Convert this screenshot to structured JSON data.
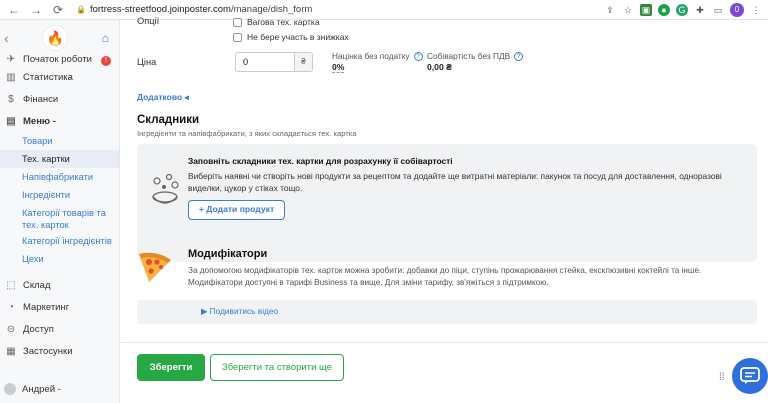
{
  "browser": {
    "url_host": "fortress-streetfood.joinposter.com",
    "url_path": "/manage/dish_form",
    "profile_initial": "0"
  },
  "sidebar": {
    "items": [
      {
        "label": "Початок роботи",
        "icon": "rocket-icon"
      },
      {
        "label": "Статистика",
        "icon": "chart-icon"
      },
      {
        "label": "Фінанси",
        "icon": "dollar-icon"
      },
      {
        "label": "Меню -",
        "icon": "book-icon"
      }
    ],
    "sub_items": [
      "Товари",
      "Тех. картки",
      "Напівфабрикати",
      "Інгредієнти",
      "Категорії товарів та тех. карток",
      "Категорії інгредієнтів",
      "Цехи"
    ],
    "bottom_items": [
      {
        "label": "Склад",
        "icon": "box-icon"
      },
      {
        "label": "Маркетинг",
        "icon": "megaphone-icon"
      },
      {
        "label": "Доступ",
        "icon": "lock-icon"
      },
      {
        "label": "Застосунки",
        "icon": "apps-icon"
      }
    ],
    "user": "Андрей -"
  },
  "form": {
    "top_partial_label": "Опції",
    "checkbox_partial": "Вагова тех. картка",
    "checkbox_discount": "Не бере участь в знижках",
    "price_label": "Ціна",
    "price_value": "0",
    "currency": "₴",
    "markup_label": "Націнка без податку",
    "markup_value": "0%",
    "cost_label": "Собівартість без ПДВ",
    "cost_value": "0,00 ₴",
    "more_link": "Додатково ◂"
  },
  "ingredients": {
    "title": "Складники",
    "subtitle": "Інгредієнти та напівфабрикати, з яких складається тех. картка",
    "box_title": "Заповніть складники тех. картки для розрахунку її собівартості",
    "box_text": "Виберіть наявні чи створіть нові продукти за рецептом та додайте ще витратні матеріали: пакунок та посуд для доставлення, одноразові виделки, цукор у стіках тощо.",
    "add_button": "+ Додати продукт"
  },
  "modifiers": {
    "title": "Модифікатори",
    "text": "За допомогою модифікаторів тех. карток можна зробити: добавки до піци, ступінь прожарювання стейка, ексклюзивні коктейлі та інше. Модифікатори доступні в тарифі Business та вище. Для зміни тарифу, зв'яжіться з підтримкою.",
    "video_link": "▶ Подивитись відео"
  },
  "actions": {
    "save": "Зберегти",
    "save_and_create": "Зберегти та створити ще"
  },
  "colors": {
    "accent": "#3b7bd4",
    "save": "#28a745",
    "chat": "#2f6fdc"
  }
}
